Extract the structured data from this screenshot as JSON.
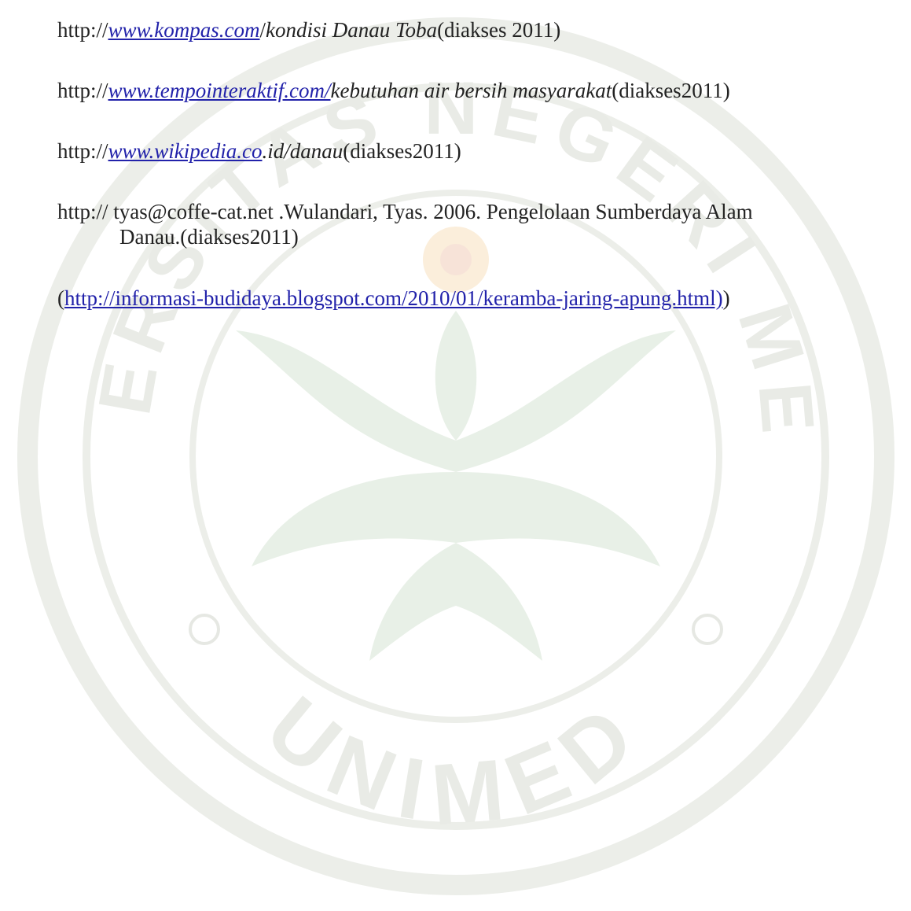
{
  "watermark": {
    "top_text": "UNIVERSITAS NEGERI MEDAN",
    "bottom_text": "UNIMED",
    "ring_color": "#e9ece6",
    "lotus_color": "#e7efe6",
    "sun_color": "#faedd9"
  },
  "references": [
    {
      "prefix": "http://",
      "link": "www.kompas.com",
      "mid": "/",
      "italic": "kondisi Danau Toba",
      "suffix": "(diakses 2011)"
    },
    {
      "prefix": "http://",
      "link": "www.tempointeraktif.com/",
      "italic": "kebutuhan air bersih masyarakat",
      "suffix": "(diakses2011)"
    },
    {
      "prefix": "http://",
      "link": "www.wikipedia.co",
      "italic": ".id/danau",
      "suffix": "(diakses2011)"
    },
    {
      "line1": "http:// tyas@coffe-cat.net .Wulandari, Tyas. 2006. Pengelolaan Sumberdaya Alam",
      "line2": "Danau.(diakses2011)"
    },
    {
      "open": "(",
      "link": "http://informasi-budidaya.blogspot.com/2010/01/keramba-jaring-apung.html)",
      "close": ")"
    }
  ]
}
